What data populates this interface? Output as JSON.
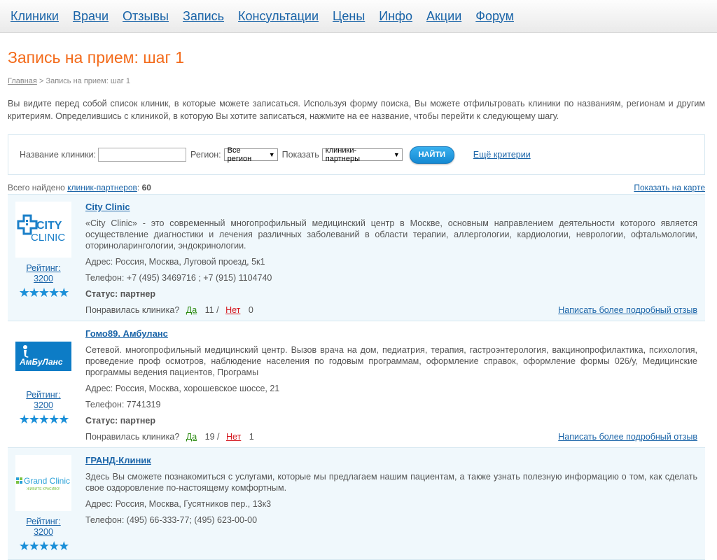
{
  "nav": [
    "Клиники",
    "Врачи",
    "Отзывы",
    "Запись",
    "Консультации",
    "Цены",
    "Инфо",
    "Акции",
    "Форум"
  ],
  "title": "Запись на прием: шаг 1",
  "breadcrumb": {
    "home": "Главная",
    "sep": ">",
    "current": "Запись на прием: шаг 1"
  },
  "intro": "Вы видите перед собой список клиник, в которые можете записаться. Используя форму поиска, Вы можете отфильтровать клиники по названиям, регионам и другим критериям. Определившись с клиникой, в которую Вы хотите записаться, нажмите на ее название, чтобы перейти к следующему шагу.",
  "search": {
    "name_label": "Название клиники:",
    "name_value": "",
    "region_label": "Регион:",
    "region_value": "Все регион",
    "show_label": "Показать",
    "show_value": "клиники-партнеры",
    "find_button": "НАЙТИ",
    "more_criteria": "Ещё критерии"
  },
  "results": {
    "prefix": "Всего найдено",
    "link": "клиник-партнеров",
    "colon": ":",
    "count": "60",
    "map_link": "Показать на карте"
  },
  "clinics": [
    {
      "name": "City Clinic",
      "logo_text_1": "CITY",
      "logo_text_2": "CLINIC",
      "rating_label": "Рейтинг:",
      "rating": "3200",
      "stars": "★★★★★",
      "description": "«City Clinic» - это современный многопрофильный медицинский центр в Москве, основным направлением деятельности которого является осуществление диагностики и лечения различных заболеваний в области терапии, аллергологии, кардиологии, неврологии, офтальмологии, оториноларингологии, эндокринологии.",
      "address": "Адрес: Россия, Москва, Луговой проезд, 5к1",
      "phone": "Телефон: +7 (495) 3469716 ; +7 (915) 1104740",
      "status": "Статус: партнер",
      "liked_label": "Понравилась клиника?",
      "yes": "Да",
      "yes_count": "11 /",
      "no": "Нет",
      "no_count": "0",
      "review_link": "Написать более подробный отзыв"
    },
    {
      "name": "Гомо89. Амбуланс",
      "logo_text_1": "АмБуЛанс",
      "logo_text_2": "",
      "rating_label": "Рейтинг:",
      "rating": "3200",
      "stars": "★★★★★",
      "description": "Сетевой. многопрофильный медицинский центр. Вызов врача на дом, педиатрия, терапия, гастроэнтерология, вакцинопрофилактика, психология, проведение проф осмотров, наблюдение населения по годовым программам, оформление справок, оформление формы 026/у, Медицинские программы ведения пациентов, Програмы",
      "address": "Адрес: Россия, Москва, хорошевское шоссе, 21",
      "phone": "Телефон: 7741319",
      "status": "Статус: партнер",
      "liked_label": "Понравилась клиника?",
      "yes": "Да",
      "yes_count": "19 /",
      "no": "Нет",
      "no_count": "1",
      "review_link": "Написать более подробный отзыв"
    },
    {
      "name": "ГРАНД-Клиник",
      "logo_text_1": "Grand Clinic",
      "logo_text_2": "ЖИВИТЕ КРАСИВО!",
      "rating_label": "Рейтинг:",
      "rating": "3200",
      "stars": "★★★★★",
      "description": "Здесь Вы сможете познакомиться с услугами, которые мы предлагаем нашим пациентам, а также узнать полезную информацию о том, как сделать свое оздоровление по-настоящему комфортным.",
      "address": "Адрес: Россия, Москва, Гусятников пер., 13к3",
      "phone": "Телефон: (495) 66-333-77; (495) 623-00-00",
      "status": "",
      "liked_label": "",
      "yes": "",
      "yes_count": "",
      "no": "",
      "no_count": "",
      "review_link": ""
    }
  ],
  "colors": {
    "accent": "#f36b1b",
    "link": "#1a64a8",
    "button": "#1589d2",
    "yes": "#2a8a10",
    "no": "#d4141c"
  }
}
